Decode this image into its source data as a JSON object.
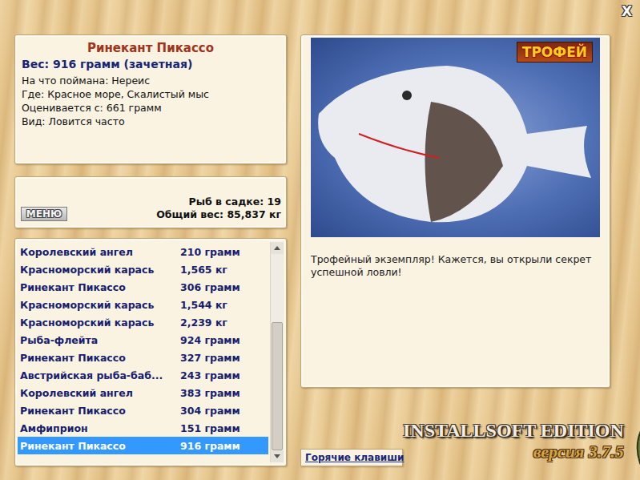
{
  "window": {
    "close": "X"
  },
  "fish_info": {
    "name": "Ринекант Пикассо",
    "weight": "Вес: 916 грамм (зачетная)",
    "details": [
      "На что поймана: Нереис",
      "Где: Красное море, Скалистый мыс",
      "Оценивается с: 661 грамм",
      "Вид: Ловится часто"
    ]
  },
  "menu_button": "МЕНЮ",
  "keepnet": {
    "count": "Рыб в садке: 19",
    "total": "Общий вес: 85,837 кг"
  },
  "catch_list": {
    "scroll_level": 1,
    "rows": [
      {
        "name": "Королевский ангел",
        "weight": "210 грамм",
        "selected": false
      },
      {
        "name": "Красноморский карась",
        "weight": "1,565 кг",
        "selected": false
      },
      {
        "name": "Ринекант Пикассо",
        "weight": "306 грамм",
        "selected": false
      },
      {
        "name": "Красноморский карась",
        "weight": "1,544 кг",
        "selected": false
      },
      {
        "name": "Красноморский карась",
        "weight": "2,239 кг",
        "selected": false
      },
      {
        "name": "Рыба-флейта",
        "weight": "924 грамм",
        "selected": false
      },
      {
        "name": "Ринекант Пикассо",
        "weight": "327 грамм",
        "selected": false
      },
      {
        "name": "Австрийская рыба-баб...",
        "weight": "243 грамм",
        "selected": false
      },
      {
        "name": "Королевский ангел",
        "weight": "383 грамм",
        "selected": false
      },
      {
        "name": "Ринекант Пикассо",
        "weight": "304 грамм",
        "selected": false
      },
      {
        "name": "Амфиприон",
        "weight": "151 грамм",
        "selected": false
      },
      {
        "name": "Ринекант Пикассо",
        "weight": "916 грамм",
        "selected": true
      }
    ]
  },
  "trophy": {
    "badge": "ТРОФЕЙ",
    "message": "Трофейный экземпляр! Кажется, вы открыли секрет успешной ловли!"
  },
  "hotkeys_button": "Горячие клавиши",
  "logo": {
    "title": "INSTALLSOFT EDITION",
    "version": "версия 3.7.5"
  }
}
